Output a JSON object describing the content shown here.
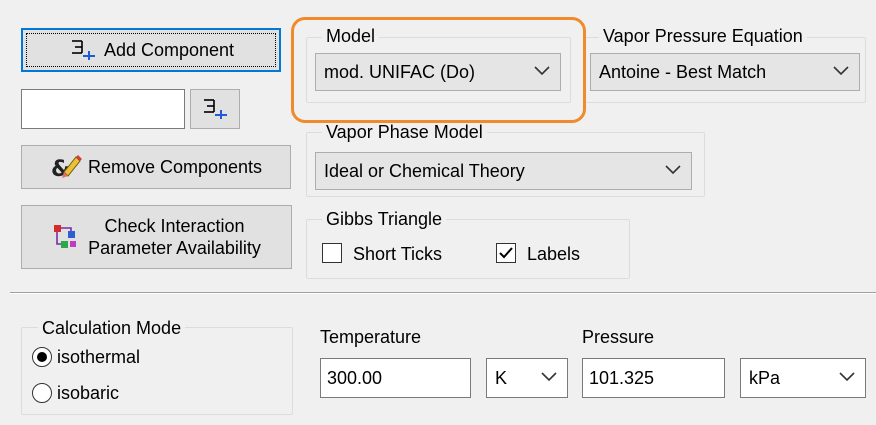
{
  "buttons": {
    "add_component": "Add Component",
    "remove_components": "Remove Components",
    "check_interaction_line1": "Check Interaction",
    "check_interaction_line2": "Parameter Availability"
  },
  "component_input": {
    "value": ""
  },
  "model": {
    "label": "Model",
    "selected": "mod. UNIFAC (Do)"
  },
  "vapor_pressure": {
    "label": "Vapor Pressure Equation",
    "selected": "Antoine - Best Match"
  },
  "vapor_phase": {
    "label": "Vapor Phase Model",
    "selected": "Ideal or Chemical Theory"
  },
  "gibbs": {
    "label": "Gibbs Triangle",
    "short_ticks": {
      "label": "Short Ticks",
      "checked": false
    },
    "labels": {
      "label": "Labels",
      "checked": true
    }
  },
  "calc_mode": {
    "label": "Calculation Mode",
    "options": [
      {
        "label": "isothermal",
        "selected": true
      },
      {
        "label": "isobaric",
        "selected": false
      }
    ]
  },
  "temperature": {
    "label": "Temperature",
    "value": "300.00",
    "unit": "K"
  },
  "pressure": {
    "label": "Pressure",
    "value": "101.325",
    "unit": "kPa"
  },
  "colors": {
    "highlight": "#f08a2c",
    "focus": "#0078d7"
  },
  "icons": [
    "add-component-icon",
    "add-component-small-icon",
    "remove-components-icon",
    "check-interaction-icon",
    "chevron-down-icon"
  ]
}
